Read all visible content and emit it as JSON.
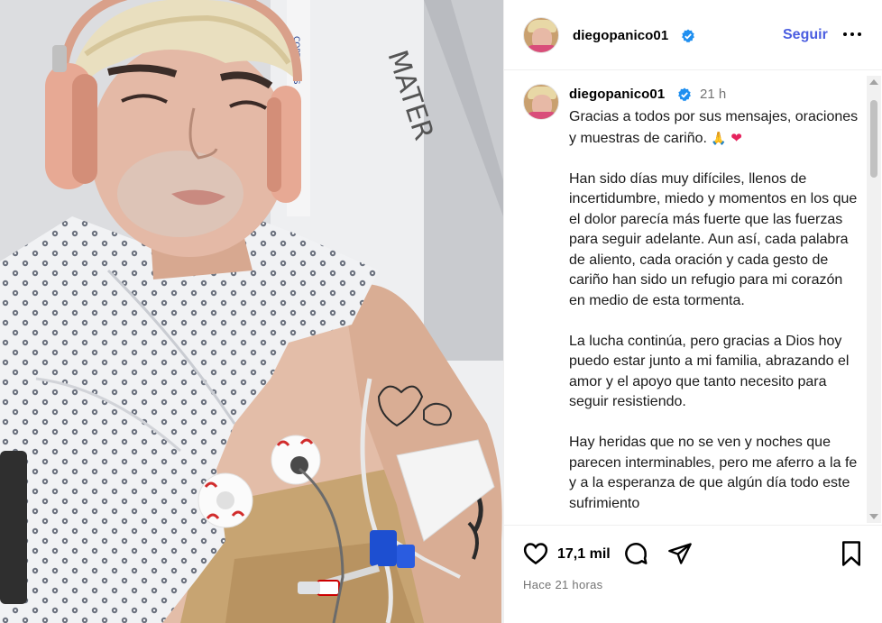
{
  "post": {
    "username": "diegopanico01",
    "time_ago": "21 h",
    "follow_label": "Seguir",
    "caption": [
      "Gracias a todos por sus mensajes, oraciones y muestras de cariño.",
      "Han sido días muy difíciles, llenos de incertidumbre, miedo y momentos en los que el dolor parecía más fuerte que las fuerzas para seguir adelante. Aun así, cada palabra de aliento, cada oración y cada gesto de cariño han sido un refugio para mi corazón en medio de esta tormenta.",
      "La lucha continúa, pero gracias a Dios hoy puedo estar junto a mi familia, abrazando el amor y el apoyo que tanto necesito para seguir resistiendo.",
      "Hay heridas que no se ven y noches que parecen interminables, pero me aferro a la fe y a la esperanza de que algún día todo este sufrimiento"
    ],
    "caption_emojis": [
      "🙏",
      "❤"
    ],
    "likes": "17,1 mil",
    "posted": "Hace 21 horas",
    "pillow_text": "MATER"
  },
  "icons": {
    "verified": "verified-badge-icon",
    "more": "more-options-icon",
    "like": "heart-icon",
    "comment": "comment-icon",
    "share": "share-icon",
    "save": "bookmark-icon"
  },
  "colors": {
    "follow": "#4a5de0",
    "verified": "#1f8ff0",
    "muted": "#737373",
    "heart_emoji": "#e6245e"
  }
}
